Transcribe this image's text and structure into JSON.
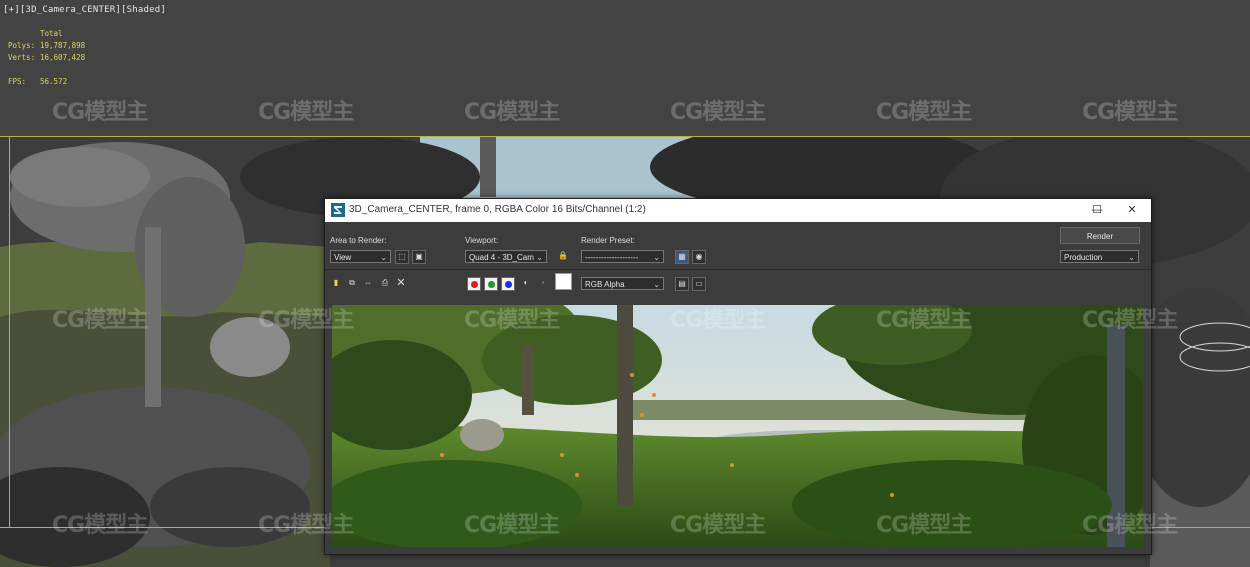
{
  "viewport": {
    "label": "[+][3D_Camera_CENTER][Shaded]",
    "stats": {
      "header": "Total",
      "rows": [
        {
          "key": "Polys:",
          "value": "19,787,898"
        },
        {
          "key": "Verts:",
          "value": "16,607,428"
        }
      ],
      "fps_key": "FPS:",
      "fps_value": "56.572"
    },
    "watermark": "CG模型主",
    "accent_color": "#b7b246"
  },
  "dialog": {
    "title": "3D_Camera_CENTER, frame 0, RGBA Color 16 Bits/Channel (1:2)",
    "window_controls": {
      "minimize": "—",
      "maximize": "☐",
      "close": "✕"
    },
    "area_label": "Area to Render:",
    "area_value": "View",
    "viewport_label": "Viewport:",
    "viewport_value": "Quad 4 - 3D_Cam",
    "preset_label": "Render Preset:",
    "preset_value": "--------------------",
    "render_button": "Render",
    "mode_value": "Production",
    "channel_value": "RGB Alpha",
    "icons": [
      "save-icon",
      "copy-icon",
      "clone-icon",
      "print-icon",
      "clear-icon",
      "lock-icon",
      "render-setup-icon",
      "environment-icon",
      "red-channel-icon",
      "green-channel-icon",
      "blue-channel-icon",
      "alpha-icon",
      "mono-icon",
      "swatch-icon"
    ]
  }
}
